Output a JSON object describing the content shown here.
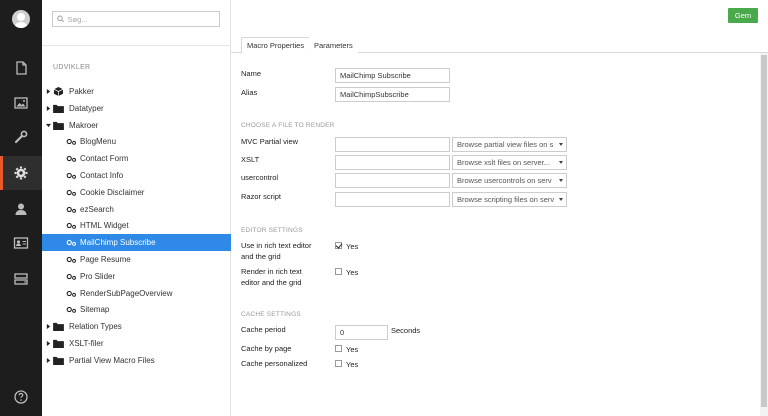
{
  "colors": {
    "nav_bg": "#1d1d1d",
    "accent": "#e85a2c",
    "selected": "#2e8ae6",
    "save": "#4aa94a"
  },
  "nav": {
    "items": [
      {
        "icon": "document-icon",
        "active": false
      },
      {
        "icon": "image-icon",
        "active": false
      },
      {
        "icon": "wrench-icon",
        "active": false
      },
      {
        "icon": "gear-icon",
        "active": true
      },
      {
        "icon": "user-icon",
        "active": false
      },
      {
        "icon": "contact-card-icon",
        "active": false
      },
      {
        "icon": "forms-icon",
        "active": false
      },
      {
        "icon": "help-icon",
        "active": false
      }
    ]
  },
  "tree": {
    "search_placeholder": "Søg...",
    "section": "UDVIKLER",
    "items": [
      {
        "label": "Pakker",
        "kind": "package",
        "level": 0,
        "arrow": "right"
      },
      {
        "label": "Datatyper",
        "kind": "folder",
        "level": 0,
        "arrow": "right"
      },
      {
        "label": "Makroer",
        "kind": "folder",
        "level": 0,
        "arrow": "down"
      },
      {
        "label": "BlogMenu",
        "kind": "macro",
        "level": 1
      },
      {
        "label": "Contact Form",
        "kind": "macro",
        "level": 1
      },
      {
        "label": "Contact Info",
        "kind": "macro",
        "level": 1
      },
      {
        "label": "Cookie Disclaimer",
        "kind": "macro",
        "level": 1
      },
      {
        "label": "ezSearch",
        "kind": "macro",
        "level": 1
      },
      {
        "label": "HTML Widget",
        "kind": "macro",
        "level": 1
      },
      {
        "label": "MailChimp Subscribe",
        "kind": "macro",
        "level": 1,
        "selected": true
      },
      {
        "label": "Page Resume",
        "kind": "macro",
        "level": 1
      },
      {
        "label": "Pro Slider",
        "kind": "macro",
        "level": 1
      },
      {
        "label": "RenderSubPageOverview",
        "kind": "macro",
        "level": 1
      },
      {
        "label": "Sitemap",
        "kind": "macro",
        "level": 1
      },
      {
        "label": "Relation Types",
        "kind": "folder",
        "level": 0,
        "arrow": "right"
      },
      {
        "label": "XSLT-filer",
        "kind": "folder",
        "level": 0,
        "arrow": "right"
      },
      {
        "label": "Partial View Macro Files",
        "kind": "folder",
        "level": 0,
        "arrow": "right"
      }
    ]
  },
  "toolbar": {
    "save_label": "Gem"
  },
  "tabs": [
    {
      "label": "Macro Properties",
      "active": true
    },
    {
      "label": "Parameters",
      "active": false
    }
  ],
  "form": {
    "name_label": "Name",
    "name_value": "MailChimp Subscribe",
    "alias_label": "Alias",
    "alias_value": "MailChimpSubscribe",
    "file_section": "CHOOSE A FILE TO RENDER",
    "file_rows": [
      {
        "label": "MVC Partial view",
        "value": "",
        "select": "Browse partial view files on s"
      },
      {
        "label": "XSLT",
        "value": "",
        "select": "Browse xslt files on server..."
      },
      {
        "label": "usercontrol",
        "value": "",
        "select": "Browse usercontrols on serv"
      },
      {
        "label": "Razor script",
        "value": "",
        "select": "Browse scripting files on serv"
      }
    ],
    "editor_section": "EDITOR SETTINGS",
    "use_in_rte_label_1": "Use in rich text editor",
    "use_in_rte_label_2": "and the grid",
    "use_in_rte_checked": true,
    "render_in_rte_label_1": "Render in rich text",
    "render_in_rte_label_2": "editor and the grid",
    "render_in_rte_checked": false,
    "yes_label": "Yes",
    "cache_section": "CACHE SETTINGS",
    "cache_period_label": "Cache period",
    "cache_period_value": "0",
    "cache_period_unit": "Seconds",
    "cache_by_page_label": "Cache by page",
    "cache_by_page_checked": false,
    "cache_personalized_label": "Cache personalized",
    "cache_personalized_checked": false
  }
}
